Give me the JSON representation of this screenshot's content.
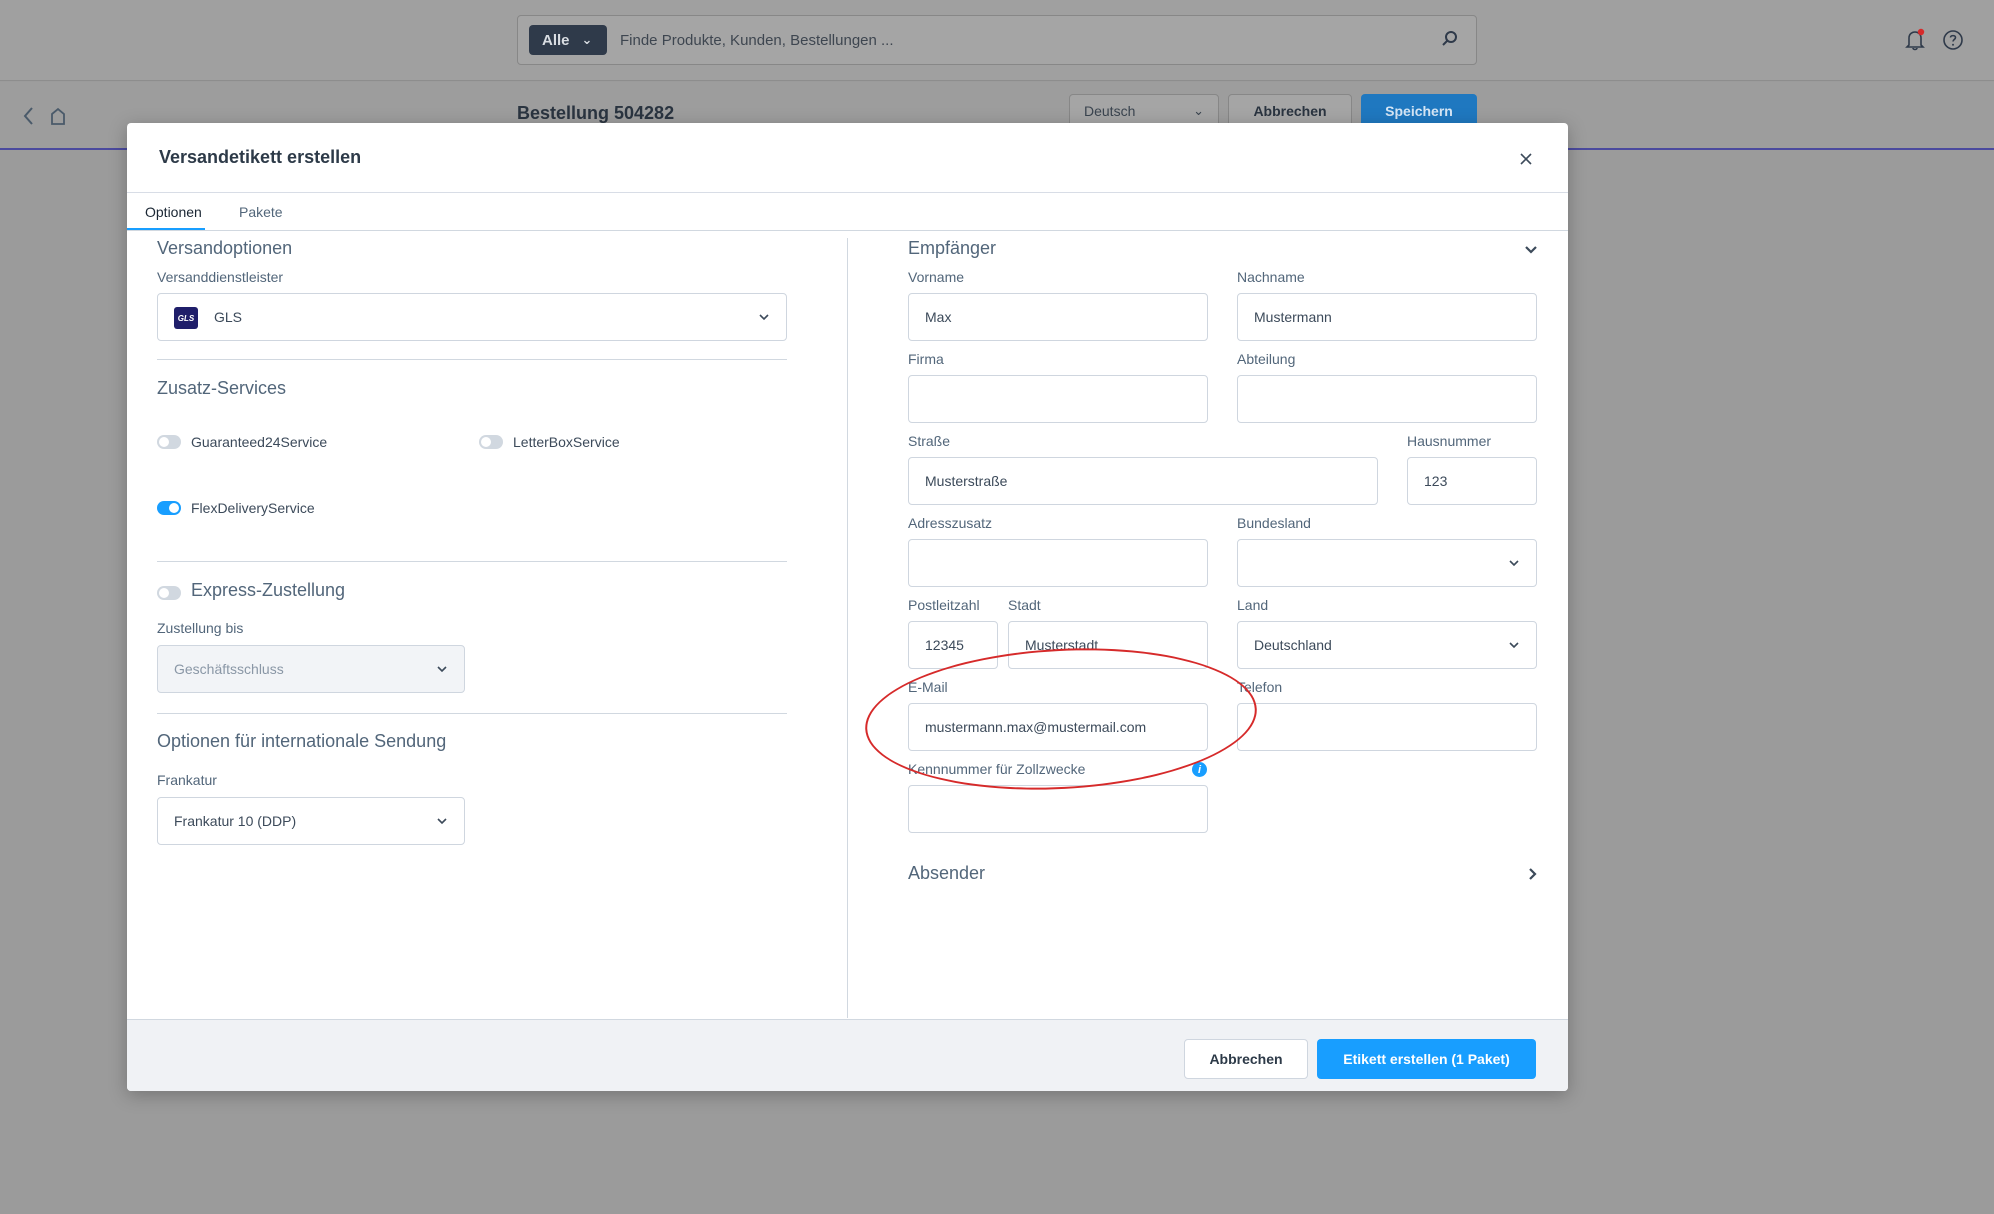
{
  "background": {
    "search": {
      "scope": "Alle",
      "placeholder": "Finde Produkte, Kunden, Bestellungen ..."
    },
    "order_title": "Bestellung 504282",
    "language": "Deutsch",
    "cancel_label": "Abbrechen",
    "save_label": "Speichern"
  },
  "modal": {
    "title": "Versandetikett erstellen",
    "tabs": [
      {
        "label": "Optionen",
        "active": true
      },
      {
        "label": "Pakete",
        "active": false
      }
    ],
    "left": {
      "shipping_options_title": "Versandoptionen",
      "carrier_label": "Versanddienstleister",
      "carrier_value": "GLS",
      "carrier_logo_text": "GLS",
      "extra_services_title": "Zusatz-Services",
      "services": [
        {
          "label": "Guaranteed24Service",
          "on": false
        },
        {
          "label": "LetterBoxService",
          "on": false
        },
        {
          "label": "FlexDeliveryService",
          "on": true
        }
      ],
      "express_label": "Express-Zustellung",
      "express_on": false,
      "delivery_until_label": "Zustellung bis",
      "delivery_until_value": "Geschäftsschluss",
      "international_title": "Optionen für internationale Sendung",
      "frankatur_label": "Frankatur",
      "frankatur_value": "Frankatur 10 (DDP)"
    },
    "right": {
      "recipient_title": "Empfänger",
      "firstname_label": "Vorname",
      "firstname_value": "Max",
      "lastname_label": "Nachname",
      "lastname_value": "Mustermann",
      "company_label": "Firma",
      "company_value": "",
      "department_label": "Abteilung",
      "department_value": "",
      "street_label": "Straße",
      "street_value": "Musterstraße",
      "housenumber_label": "Hausnummer",
      "housenumber_value": "123",
      "address_extra_label": "Adresszusatz",
      "address_extra_value": "",
      "state_label": "Bundesland",
      "state_value": "",
      "zip_label": "Postleitzahl",
      "zip_value": "12345",
      "city_label": "Stadt",
      "city_value": "Musterstadt",
      "country_label": "Land",
      "country_value": "Deutschland",
      "email_label": "E-Mail",
      "email_value": "mustermann.max@mustermail.com",
      "phone_label": "Telefon",
      "phone_value": "",
      "customs_label": "Kennnummer für Zollzwecke",
      "customs_value": "",
      "sender_title": "Absender"
    },
    "footer": {
      "cancel_label": "Abbrechen",
      "create_label": "Etikett erstellen (1 Paket)"
    }
  },
  "colors": {
    "primary": "#189eff",
    "annotation": "#d62a2a",
    "overlay": "#9b9b9b"
  }
}
